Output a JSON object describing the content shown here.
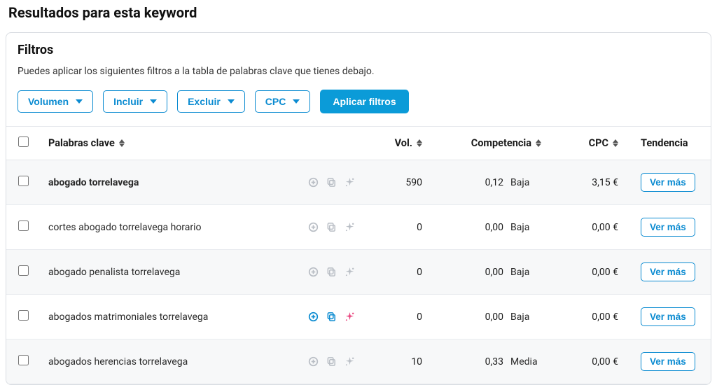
{
  "page_title": "Resultados para esta keyword",
  "filters": {
    "title": "Filtros",
    "description": "Puedes aplicar los siguientes filtros a la tabla de palabras clave que tienes debajo.",
    "buttons": {
      "volumen": "Volumen",
      "incluir": "Incluir",
      "excluir": "Excluir",
      "cpc": "CPC"
    },
    "apply": "Aplicar filtros"
  },
  "table": {
    "headers": {
      "keyword": "Palabras clave",
      "volume": "Vol.",
      "competition": "Competencia",
      "cpc": "CPC",
      "trend": "Tendencia"
    },
    "vermas": "Ver más",
    "rows": [
      {
        "keyword": "abogado torrelavega",
        "bold": true,
        "vol": "590",
        "comp_num": "0,12",
        "comp_label": "Baja",
        "cpc": "3,15 €",
        "icons": "muted"
      },
      {
        "keyword": "cortes abogado torrelavega horario",
        "bold": false,
        "vol": "0",
        "comp_num": "0,00",
        "comp_label": "Baja",
        "cpc": "0,00 €",
        "icons": "muted"
      },
      {
        "keyword": "abogado penalista torrelavega",
        "bold": false,
        "vol": "0",
        "comp_num": "0,00",
        "comp_label": "Baja",
        "cpc": "0,00 €",
        "icons": "muted"
      },
      {
        "keyword": "abogados matrimoniales torrelavega",
        "bold": false,
        "vol": "0",
        "comp_num": "0,00",
        "comp_label": "Baja",
        "cpc": "0,00 €",
        "icons": "active"
      },
      {
        "keyword": "abogados herencias torrelavega",
        "bold": false,
        "vol": "10",
        "comp_num": "0,33",
        "comp_label": "Media",
        "cpc": "0,00 €",
        "icons": "muted"
      }
    ]
  }
}
